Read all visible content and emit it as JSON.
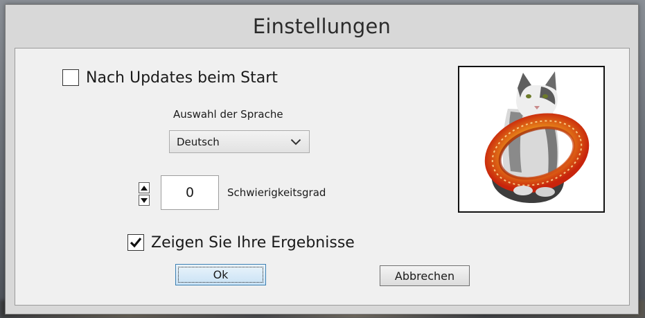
{
  "window": {
    "title": "Einstellungen"
  },
  "settings": {
    "updates_checkbox": {
      "label": "Nach Updates beim Start",
      "checked": false
    },
    "language": {
      "label": "Auswahl der Sprache",
      "selected": "Deutsch"
    },
    "difficulty": {
      "value": "0",
      "label": "Schwierigkeitsgrad"
    },
    "results_checkbox": {
      "label": "Zeigen Sie Ihre Ergebnisse",
      "checked": true
    }
  },
  "buttons": {
    "ok_label": "Ok",
    "cancel_label": "Abbrechen"
  },
  "icons": {
    "chevron": "chevron-down-icon",
    "spin_up": "arrow-up-icon",
    "spin_down": "arrow-down-icon",
    "check": "checkmark-icon"
  },
  "colors": {
    "window_bg": "#d8d8d8",
    "client_bg": "#f0f0f0",
    "ok_focus_border": "#3c7fb1",
    "ring_gold": "#f2a81e",
    "ring_red": "#d8360f"
  }
}
